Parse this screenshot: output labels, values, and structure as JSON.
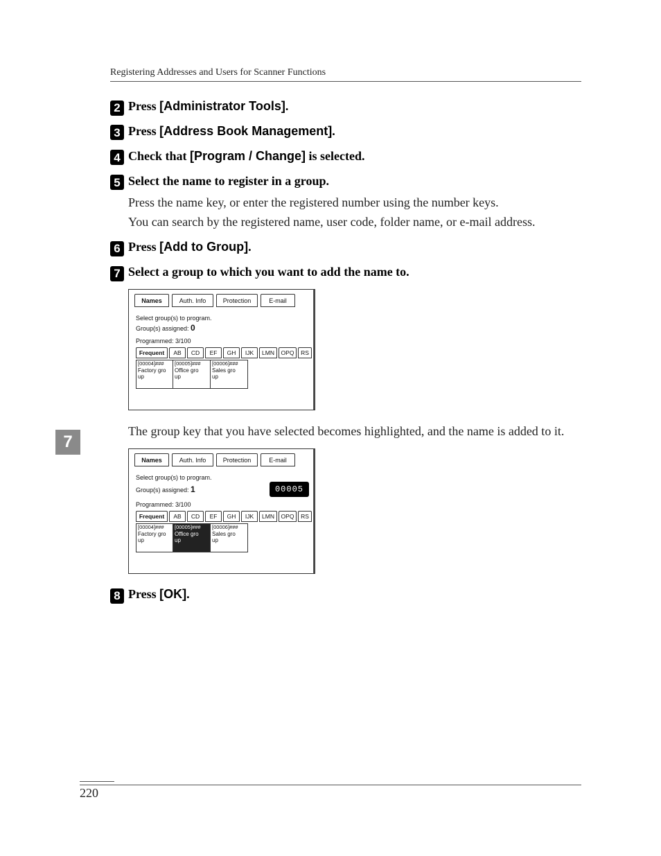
{
  "header": {
    "breadcrumb": "Registering Addresses and Users for Scanner Functions"
  },
  "page": {
    "number": "220",
    "side_tab": "7"
  },
  "steps": {
    "s2": {
      "num": "2",
      "press": "Press ",
      "label": "[Administrator Tools]",
      "tail": "."
    },
    "s3": {
      "num": "3",
      "press": "Press ",
      "label": "[Address Book Management]",
      "tail": "."
    },
    "s4": {
      "num": "4",
      "pre": "Check that ",
      "label": "[Program / Change]",
      "tail": " is selected."
    },
    "s5": {
      "num": "5",
      "head": "Select the name to register in a group.",
      "p1": "Press the name key, or enter the registered number using the number keys.",
      "p2": "You can search by the registered name, user code, folder name, or e-mail address."
    },
    "s6": {
      "num": "6",
      "press": "Press ",
      "label": "[Add to Group]",
      "tail": "."
    },
    "s7": {
      "num": "7",
      "head": "Select a group to which you want to add the name to.",
      "after": "The group key that you have selected becomes highlighted, and the name is added to it."
    },
    "s8": {
      "num": "8",
      "press": "Press ",
      "label": "[OK]",
      "tail": "."
    }
  },
  "panel": {
    "tabs": {
      "names": "Names",
      "auth": "Auth. Info",
      "prot": "Protection",
      "email": "E-mail"
    },
    "instruction": "Select group(s) to program.",
    "assigned_label": "Group(s) assigned:",
    "assigned_before": "0",
    "assigned_after": "1",
    "id_badge": "00005",
    "programmed_label": "Programmed:",
    "programmed_value": "3/100",
    "alpha": [
      "Frequent",
      "AB",
      "CD",
      "EF",
      "GH",
      "IJK",
      "LMN",
      "OPQ",
      "RS"
    ],
    "alpha_active_index": 0,
    "groups": [
      {
        "code": "[00004]###",
        "name": "Factory group"
      },
      {
        "code": "[00005]###",
        "name": "Office group"
      },
      {
        "code": "[00006]###",
        "name": "Sales group"
      }
    ],
    "selected_before_index": -1,
    "selected_after_index": 1
  }
}
